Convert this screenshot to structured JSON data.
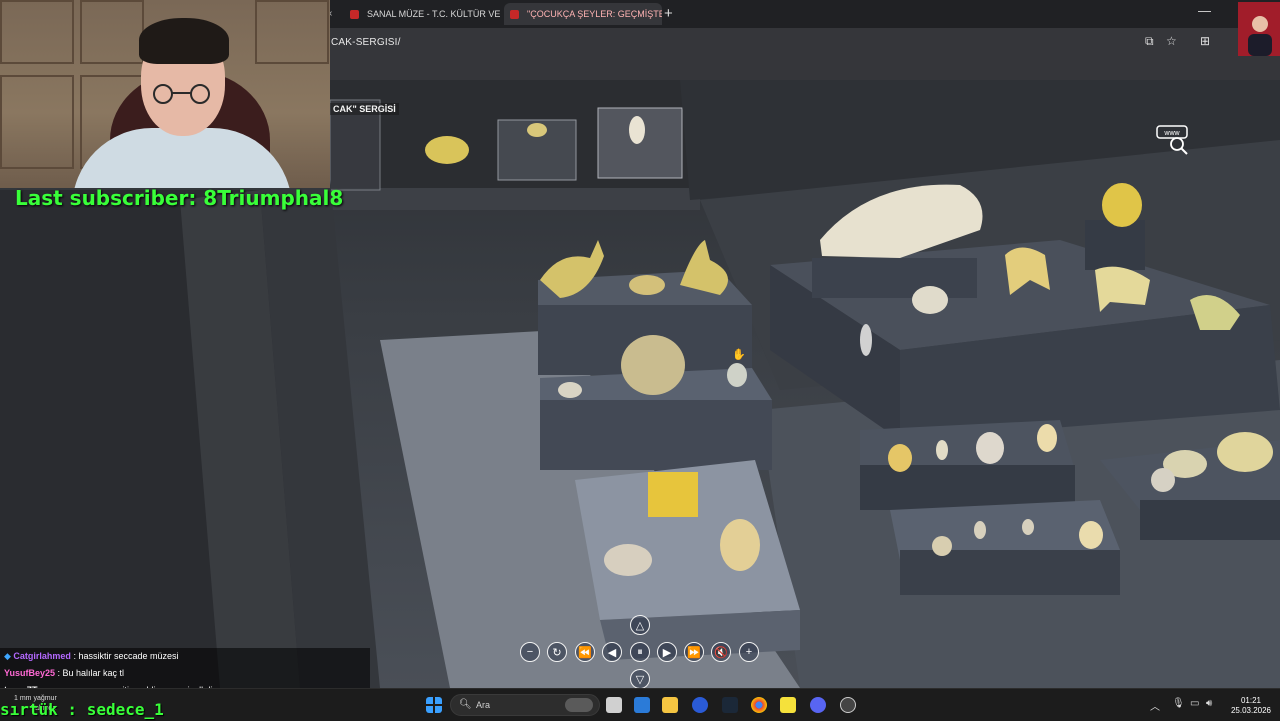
{
  "browser": {
    "tabs": [
      {
        "label": "SANAL MÜZE - T.C. KÜLTÜR VE",
        "active": false
      },
      {
        "label": "\"ÇOCUKÇA ŞEYLER: GEÇMİŞTEN",
        "active": true
      }
    ],
    "url": "CAK-SERGISI/"
  },
  "scene": {
    "exhibit_label": "CAK\" SERGİSİ",
    "www_label": "www"
  },
  "stream": {
    "last_subscriber": "Last subscriber: 8Triumphal8",
    "chat": [
      {
        "user": "Catgirlahmed",
        "message": " : hassiktir seccade müzesi",
        "color": "#b469ff"
      },
      {
        "user": "YusufBey25",
        "message": " : Bu halılar kaç tl",
        "color": "#ff69d4"
      },
      {
        "user": "turanZT",
        "message": " : memo sen ne ara gitin geldin ya aq jaslkdjas",
        "color": "#ffffff"
      }
    ],
    "weather_line1": "1 mm yağmur",
    "weather_line2": "Yakında",
    "sirtuk": "sırtük : sedece_1"
  },
  "taskbar": {
    "search_placeholder": "Ara",
    "time": "01:21",
    "date": "25.03.2026"
  },
  "colors": {
    "subscriber_green": "#39ff39",
    "accent_red": "#c62828"
  }
}
